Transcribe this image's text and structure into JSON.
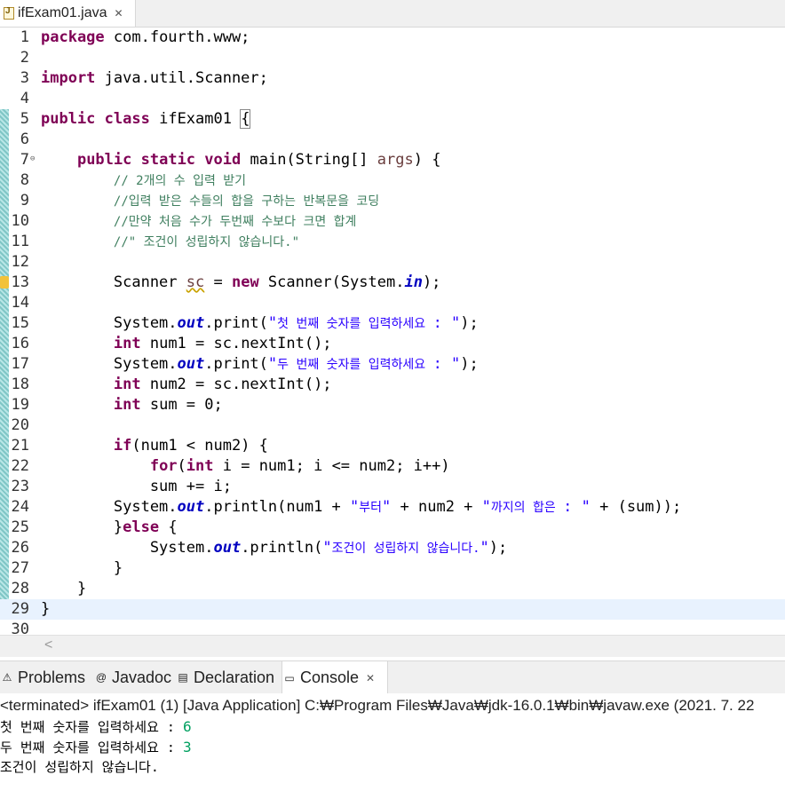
{
  "editor_tab": {
    "title": "ifExam01.java",
    "close": "✕",
    "icon": "java-file-icon"
  },
  "code_lines": [
    {
      "n": "1",
      "html": "<span class='kw'>package</span> com.fourth.www;"
    },
    {
      "n": "2",
      "html": ""
    },
    {
      "n": "3",
      "html": "<span class='kw'>import</span> java.util.Scanner;"
    },
    {
      "n": "4",
      "html": ""
    },
    {
      "n": "5",
      "html": "<span class='kw'>public</span> <span class='kw'>class</span> ifExam01 <span class='brace'>{</span>"
    },
    {
      "n": "6",
      "html": ""
    },
    {
      "n": "7",
      "html": "    <span class='kw'>public</span> <span class='kw'>static</span> <span class='kw'>void</span> main(String[] <span style='color:#6a3e3e'>args</span>) {"
    },
    {
      "n": "8",
      "html": "        <span class='cm'>// 2개의 수 입력 받기</span>"
    },
    {
      "n": "9",
      "html": "        <span class='cm'>//입력 받은 수들의 합을 구하는 반복문을 코딩</span>"
    },
    {
      "n": "10",
      "html": "        <span class='cm'>//만약 처음 수가 두번째 수보다 크면 합계</span>"
    },
    {
      "n": "11",
      "html": "        <span class='cm'>//\" 조건이 성립하지 않습니다.\"</span>"
    },
    {
      "n": "12",
      "html": ""
    },
    {
      "n": "13",
      "html": "        Scanner <span class='warn-var' style='color:#6a3e3e'>sc</span> = <span class='kw'>new</span> Scanner(System.<span class='fld'>in</span>);"
    },
    {
      "n": "14",
      "html": ""
    },
    {
      "n": "15",
      "html": "        System.<span class='fld'>out</span>.print(<span class='st'>\"<span class='st-k'>첫 번째 숫자를 입력하세요 </span>: \"</span>);"
    },
    {
      "n": "16",
      "html": "        <span class='kw'>int</span> num1 = sc.nextInt();"
    },
    {
      "n": "17",
      "html": "        System.<span class='fld'>out</span>.print(<span class='st'>\"<span class='st-k'>두 번째 숫자를 입력하세요 </span>: \"</span>);"
    },
    {
      "n": "18",
      "html": "        <span class='kw'>int</span> num2 = sc.nextInt();"
    },
    {
      "n": "19",
      "html": "        <span class='kw'>int</span> sum = 0;"
    },
    {
      "n": "20",
      "html": ""
    },
    {
      "n": "21",
      "html": "        <span class='kw'>if</span>(num1 &lt; num2) {"
    },
    {
      "n": "22",
      "html": "            <span class='kw'>for</span>(<span class='kw'>int</span> i = num1; i &lt;= num2; i++)"
    },
    {
      "n": "23",
      "html": "            sum += i;"
    },
    {
      "n": "24",
      "html": "        System.<span class='fld'>out</span>.println(num1 + <span class='st'>\"<span class='st-k'>부터</span>\"</span> + num2 + <span class='st'>\"<span class='st-k'>까지의 합은 </span>: \"</span> + (sum));"
    },
    {
      "n": "25",
      "html": "        }<span class='kw'>else</span> {"
    },
    {
      "n": "26",
      "html": "            System.<span class='fld'>out</span>.println(<span class='st'>\"<span class='st-k'>조건이 성립하지 않습니다.</span>\"</span>);"
    },
    {
      "n": "27",
      "html": "        }"
    },
    {
      "n": "28",
      "html": "    }"
    },
    {
      "n": "29",
      "html": "}"
    },
    {
      "n": "30",
      "html": ""
    }
  ],
  "fold_marker": "⊖",
  "views_tabs": [
    {
      "label": "Problems",
      "icon": "problems-icon",
      "glyph": "⚠"
    },
    {
      "label": "Javadoc",
      "icon": "javadoc-icon",
      "glyph": "@"
    },
    {
      "label": "Declaration",
      "icon": "declaration-icon",
      "glyph": "▤"
    },
    {
      "label": "Console",
      "icon": "console-icon",
      "glyph": "▭",
      "close": "✕"
    }
  ],
  "console": {
    "status": "<terminated> ifExam01 (1) [Java Application] C:₩Program Files₩Java₩jdk-16.0.1₩bin₩javaw.exe  (2021. 7. 22",
    "line1_prompt": "첫 번째 숫자를 입력하세요 : ",
    "line1_input": "6",
    "line2_prompt": "두 번째 숫자를 입력하세요 : ",
    "line2_input": "3",
    "line3": "조건이 성립하지 않습니다."
  },
  "scroll_left": "<"
}
